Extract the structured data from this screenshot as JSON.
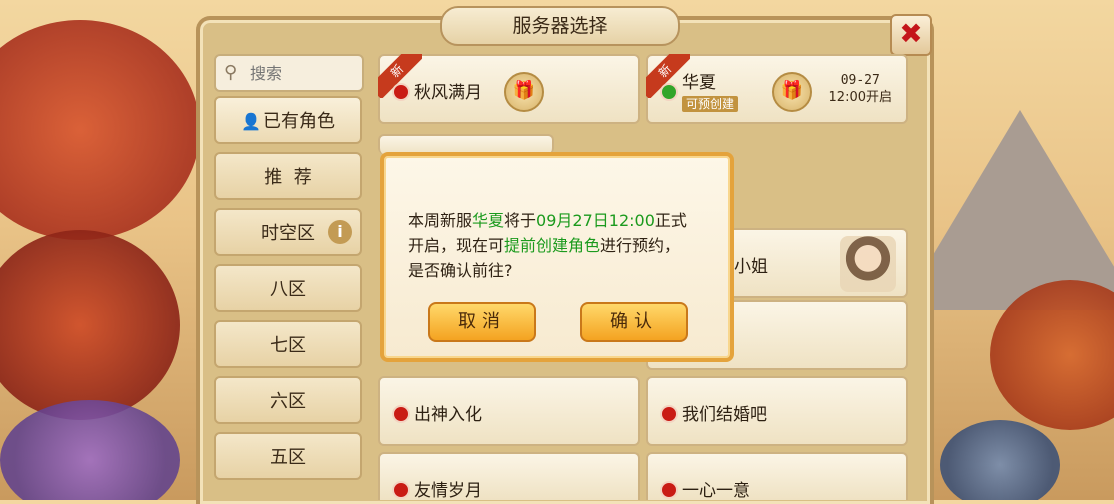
{
  "window": {
    "title": "服务器选择"
  },
  "search": {
    "placeholder": "搜索"
  },
  "sidebar": {
    "items": [
      {
        "label": "已有角色"
      },
      {
        "label": "推  荐"
      },
      {
        "label": "时空区"
      },
      {
        "label": "八区"
      },
      {
        "label": "七区"
      },
      {
        "label": "六区"
      },
      {
        "label": "五区"
      }
    ]
  },
  "servers": [
    {
      "name": "秋风满月",
      "tag": "新",
      "status": "red"
    },
    {
      "name": "华夏",
      "tag": "新",
      "status": "green",
      "badge": "可预创建",
      "date": "09-27",
      "time": "12:00开启"
    },
    {
      "name": "小姐",
      "status": "red"
    },
    {
      "name": "出神入化",
      "status": "red"
    },
    {
      "name": "我们结婚吧",
      "status": "red"
    },
    {
      "name": "友情岁月",
      "status": "red"
    },
    {
      "name": "一心一意",
      "status": "red"
    }
  ],
  "dialog": {
    "line1_a": "本周新服",
    "line1_server": "华夏",
    "line1_b": "将于",
    "line1_date": "09月27日12:00",
    "line1_c": "正式",
    "line2_a": "开启，现在可",
    "line2_link": "提前创建角色",
    "line2_b": "进行预约，",
    "line3": "是否确认前往?",
    "cancel_label": "取消",
    "confirm_label": "确认"
  },
  "colors": {
    "accent": "#1b9a1d",
    "dialog_border": "#e4a33c",
    "button": "#f4a321",
    "status_red": "#c91b14",
    "status_green": "#31a52a"
  },
  "icons": {
    "close": "close-x-icon",
    "gift": "gift-icon",
    "search": "search-icon",
    "user": "user-icon",
    "info": "info-icon"
  }
}
